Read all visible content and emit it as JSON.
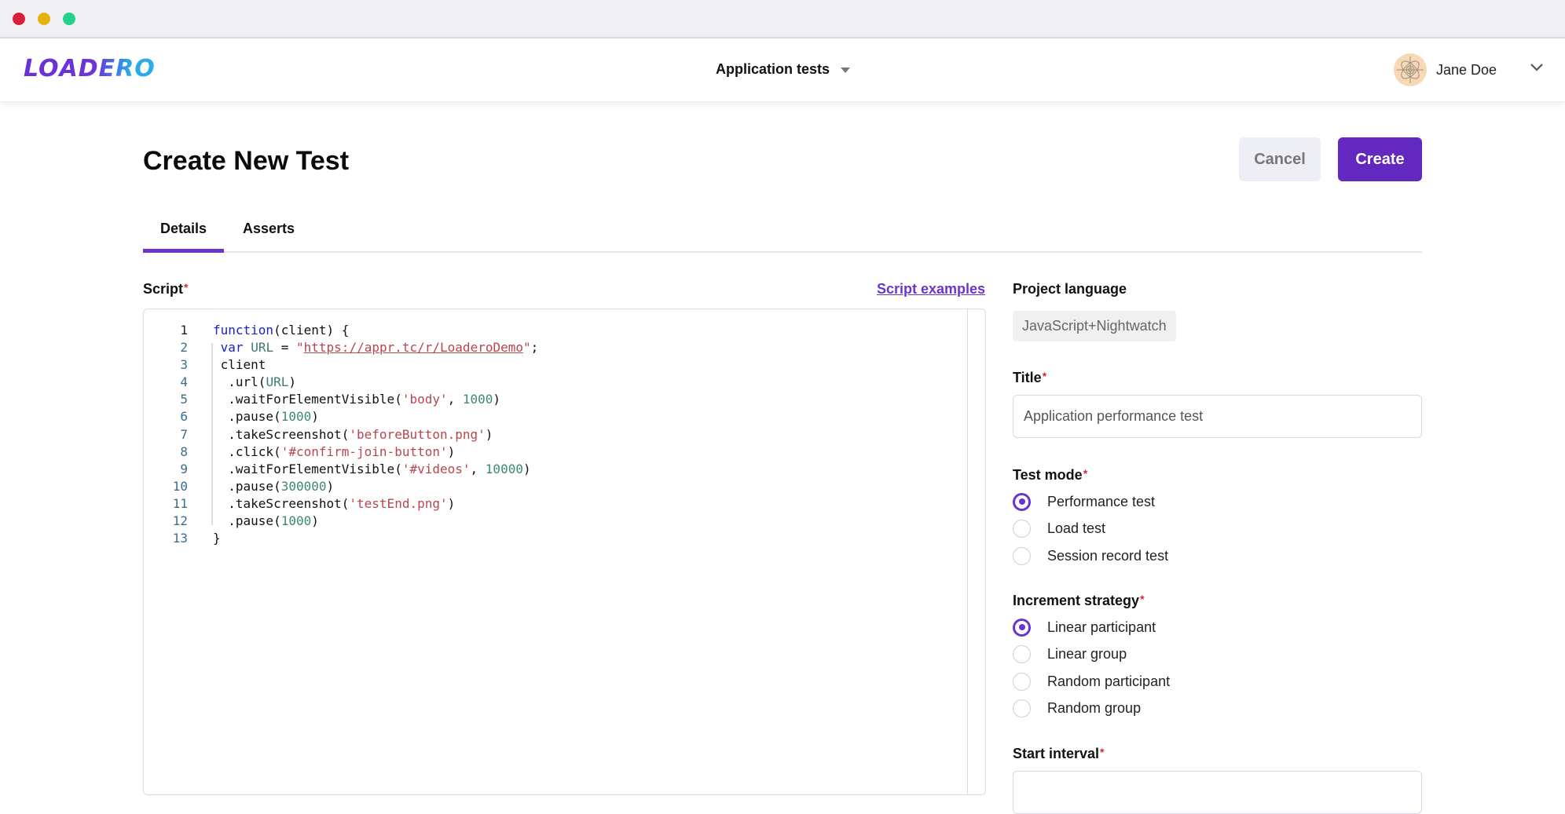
{
  "window": {
    "controls": [
      "close",
      "minimize",
      "maximize"
    ]
  },
  "nav": {
    "logo": "LOADERO",
    "project": "Application tests",
    "user_name": "Jane Doe"
  },
  "header": {
    "title": "Create New Test",
    "cancel_label": "Cancel",
    "create_label": "Create"
  },
  "tabs": [
    {
      "label": "Details",
      "active": true
    },
    {
      "label": "Asserts",
      "active": false
    }
  ],
  "script": {
    "label": "Script",
    "required_mark": "*",
    "examples_link": "Script examples",
    "lines": [
      {
        "n": "1",
        "tokens": [
          {
            "t": "function",
            "c": "kw"
          },
          {
            "t": "(client) {",
            "c": ""
          }
        ]
      },
      {
        "n": "2",
        "tokens": [
          {
            "t": " ",
            "c": ""
          },
          {
            "t": "var",
            "c": "kw"
          },
          {
            "t": " ",
            "c": ""
          },
          {
            "t": "URL",
            "c": "var"
          },
          {
            "t": " = ",
            "c": ""
          },
          {
            "t": "\"",
            "c": "str"
          },
          {
            "t": "https://appr.tc/r/LoaderoDemo",
            "c": "str link"
          },
          {
            "t": "\"",
            "c": "str"
          },
          {
            "t": ";",
            "c": ""
          }
        ]
      },
      {
        "n": "3",
        "tokens": [
          {
            "t": " client",
            "c": ""
          }
        ]
      },
      {
        "n": "4",
        "tokens": [
          {
            "t": "  .url(",
            "c": ""
          },
          {
            "t": "URL",
            "c": "var"
          },
          {
            "t": ")",
            "c": ""
          }
        ]
      },
      {
        "n": "5",
        "tokens": [
          {
            "t": "  .waitForElementVisible(",
            "c": ""
          },
          {
            "t": "'body'",
            "c": "str"
          },
          {
            "t": ", ",
            "c": ""
          },
          {
            "t": "1000",
            "c": "num"
          },
          {
            "t": ")",
            "c": ""
          }
        ]
      },
      {
        "n": "6",
        "tokens": [
          {
            "t": "  .pause(",
            "c": ""
          },
          {
            "t": "1000",
            "c": "num"
          },
          {
            "t": ")",
            "c": ""
          }
        ]
      },
      {
        "n": "7",
        "tokens": [
          {
            "t": "  .takeScreenshot(",
            "c": ""
          },
          {
            "t": "'beforeButton.png'",
            "c": "str"
          },
          {
            "t": ")",
            "c": ""
          }
        ]
      },
      {
        "n": "8",
        "tokens": [
          {
            "t": "  .click(",
            "c": ""
          },
          {
            "t": "'#confirm-join-button'",
            "c": "str"
          },
          {
            "t": ")",
            "c": ""
          }
        ]
      },
      {
        "n": "9",
        "tokens": [
          {
            "t": "  .waitForElementVisible(",
            "c": ""
          },
          {
            "t": "'#videos'",
            "c": "str"
          },
          {
            "t": ", ",
            "c": ""
          },
          {
            "t": "10000",
            "c": "num"
          },
          {
            "t": ")",
            "c": ""
          }
        ]
      },
      {
        "n": "10",
        "tokens": [
          {
            "t": "  .pause(",
            "c": ""
          },
          {
            "t": "300000",
            "c": "num"
          },
          {
            "t": ")",
            "c": ""
          }
        ]
      },
      {
        "n": "11",
        "tokens": [
          {
            "t": "  .takeScreenshot(",
            "c": ""
          },
          {
            "t": "'testEnd.png'",
            "c": "str"
          },
          {
            "t": ")",
            "c": ""
          }
        ]
      },
      {
        "n": "12",
        "tokens": [
          {
            "t": "  .pause(",
            "c": ""
          },
          {
            "t": "1000",
            "c": "num"
          },
          {
            "t": ")",
            "c": ""
          }
        ]
      },
      {
        "n": "13",
        "tokens": [
          {
            "t": "}",
            "c": ""
          }
        ]
      }
    ]
  },
  "form": {
    "project_language_label": "Project language",
    "project_language_value": "JavaScript+Nightwatch",
    "title_label": "Title",
    "title_value": "Application performance test",
    "test_mode_label": "Test mode",
    "test_mode_options": [
      {
        "label": "Performance test",
        "selected": true
      },
      {
        "label": "Load test",
        "selected": false
      },
      {
        "label": "Session record test",
        "selected": false
      }
    ],
    "increment_label": "Increment strategy",
    "increment_options": [
      {
        "label": "Linear participant",
        "selected": true
      },
      {
        "label": "Linear group",
        "selected": false
      },
      {
        "label": "Random participant",
        "selected": false
      },
      {
        "label": "Random group",
        "selected": false
      }
    ],
    "start_interval_label": "Start interval",
    "required_mark": "*"
  },
  "colors": {
    "accent": "#6228c0",
    "required": "#d6263b",
    "traffic_red": "#d81f3a",
    "traffic_yellow": "#e6b20e",
    "traffic_green": "#22d18b"
  }
}
